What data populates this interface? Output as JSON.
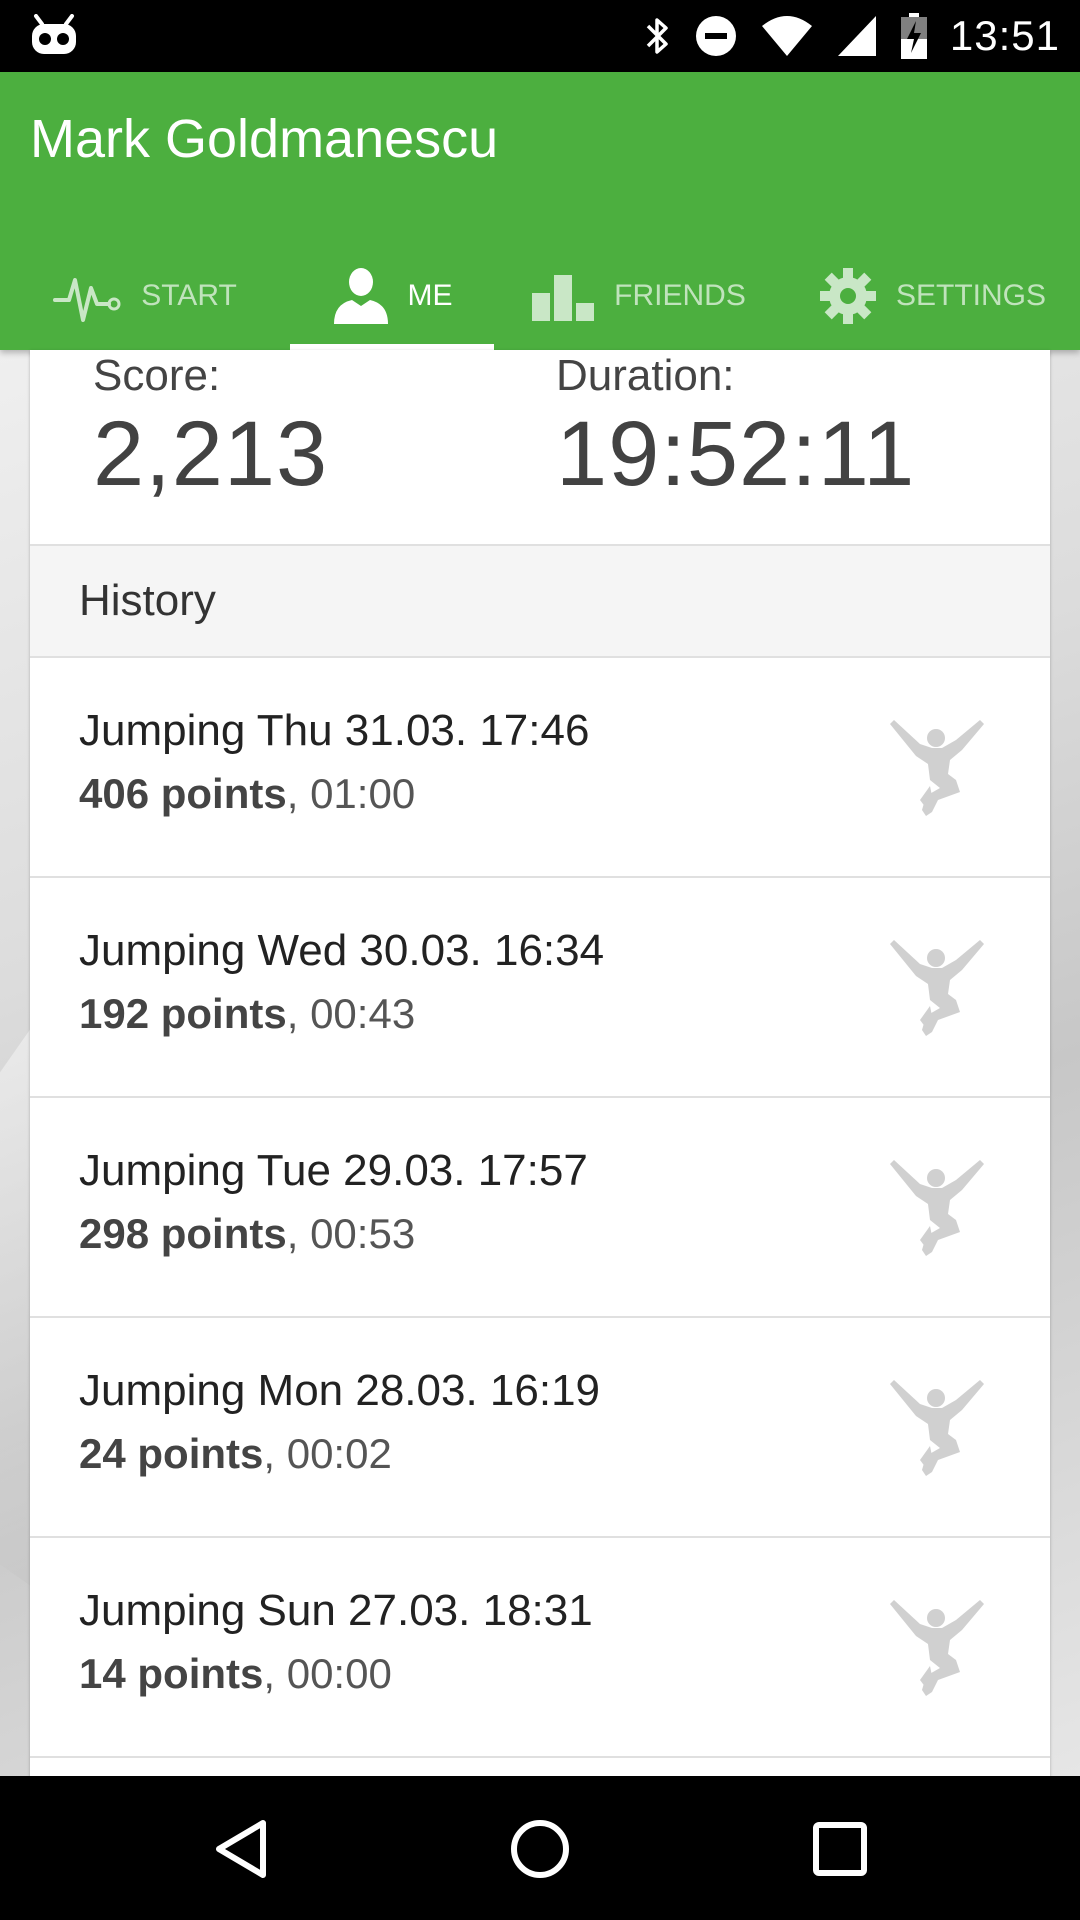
{
  "status_bar": {
    "time": "13:51",
    "icons": [
      "android-robot-icon",
      "bluetooth-icon",
      "do-not-disturb-icon",
      "wifi-icon",
      "cell-signal-icon",
      "battery-charging-icon"
    ]
  },
  "app_bar": {
    "title": "Mark Goldmanescu",
    "color": "#4caf3f",
    "tabs": [
      {
        "label": "START",
        "icon": "pulse-icon",
        "active": false
      },
      {
        "label": "ME",
        "icon": "person-icon",
        "active": true
      },
      {
        "label": "FRIENDS",
        "icon": "leaderboard-icon",
        "active": false
      },
      {
        "label": "SETTINGS",
        "icon": "gear-icon",
        "active": false
      }
    ]
  },
  "stats": {
    "score_label": "Score:",
    "score_value": "2,213",
    "duration_label": "Duration:",
    "duration_value": "19:52:11"
  },
  "history": {
    "header": "History",
    "items": [
      {
        "title": "Jumping Thu 31.03. 17:46",
        "points": "406 points",
        "time": ", 01:00",
        "icon": "jumper-icon"
      },
      {
        "title": "Jumping Wed 30.03. 16:34",
        "points": "192 points",
        "time": ", 00:43",
        "icon": "jumper-icon"
      },
      {
        "title": "Jumping Tue 29.03. 17:57",
        "points": "298 points",
        "time": ", 00:53",
        "icon": "jumper-icon"
      },
      {
        "title": "Jumping Mon 28.03. 16:19",
        "points": "24 points",
        "time": ", 00:02",
        "icon": "jumper-icon"
      },
      {
        "title": "Jumping Sun 27.03. 18:31",
        "points": "14 points",
        "time": ", 00:00",
        "icon": "jumper-icon"
      }
    ]
  },
  "nav_bar": {
    "buttons": [
      "back-icon",
      "home-icon",
      "recents-icon"
    ]
  }
}
